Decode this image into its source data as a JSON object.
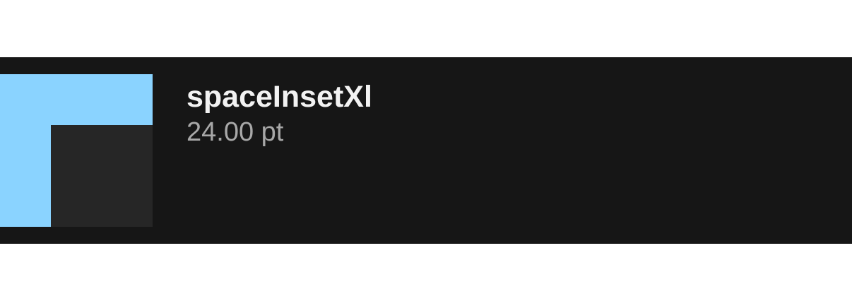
{
  "token": {
    "name": "spaceInsetXl",
    "value": "24.00 pt"
  },
  "colors": {
    "row_background": "#161616",
    "swatch_outer": "#8ad3ff",
    "swatch_inner": "#262626",
    "name_text": "#f2f2f2",
    "value_text": "#a8a8a8"
  }
}
